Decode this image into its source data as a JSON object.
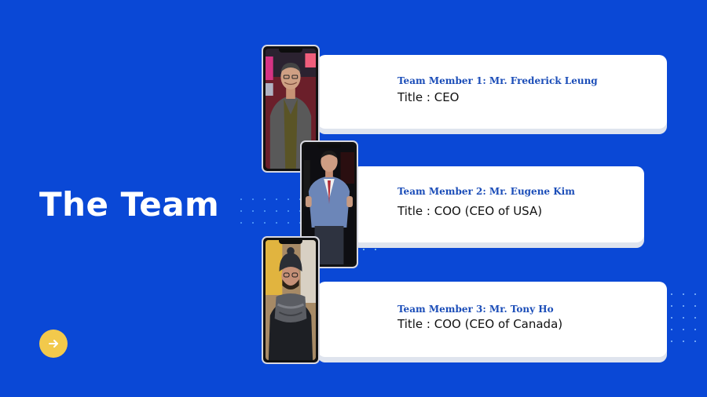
{
  "slide": {
    "heading": "The Team"
  },
  "navigation": {
    "next_icon": "arrow-right-icon"
  },
  "members": [
    {
      "name": "Team Member 1: Mr. Frederick Leung",
      "title": "Title : CEO",
      "photo_icon": "person-photo"
    },
    {
      "name": "Team Member 2: Mr. Eugene Kim",
      "title": "Title : COO (CEO of USA)",
      "photo_icon": "person-photo"
    },
    {
      "name": "Team Member 3: Mr. Tony Ho",
      "title": "Title : COO (CEO of Canada)",
      "photo_icon": "person-photo"
    }
  ],
  "colors": {
    "background": "#0a48d6",
    "button": "#f2c94c",
    "name_text": "#1b4db8",
    "card": "#ffffff"
  }
}
